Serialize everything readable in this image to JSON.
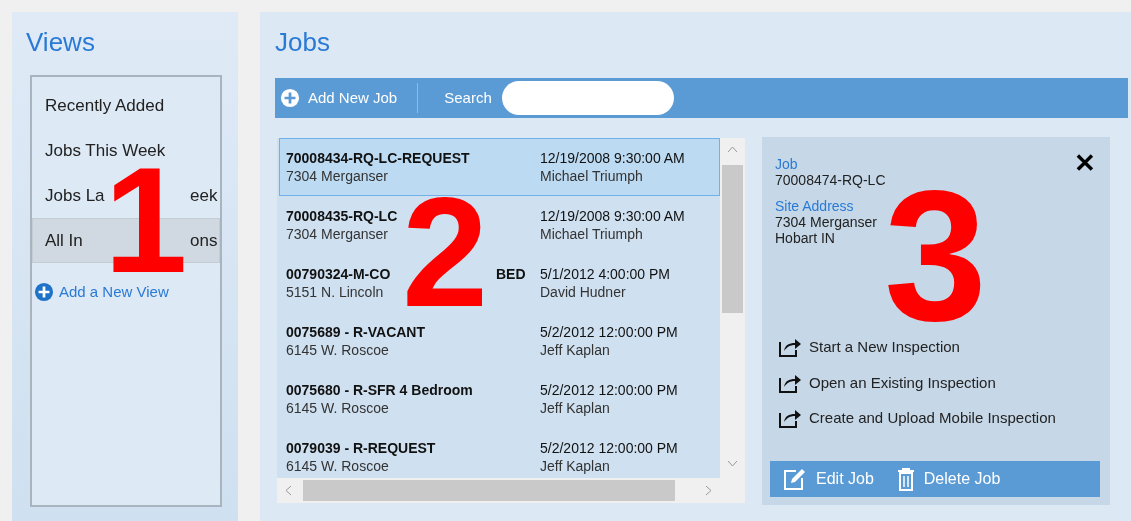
{
  "views": {
    "title": "Views",
    "items": [
      {
        "label": [
          "Recently Added"
        ],
        "selected": false
      },
      {
        "label": [
          "Jobs This Week"
        ],
        "selected": false
      },
      {
        "label": [
          "Jobs La",
          "eek"
        ],
        "selected": false
      },
      {
        "label": [
          "All In",
          "ons"
        ],
        "selected": true
      }
    ],
    "add_link": [
      "Add a New View"
    ]
  },
  "jobs": {
    "title": "Jobs",
    "toolbar": {
      "add_button": "Add New Job",
      "search_label": "Search"
    },
    "rows": [
      {
        "job": [
          "70008434-RQ-LC-REQUEST"
        ],
        "address": "7304 Merganser",
        "date": "12/19/2008 9:30:00 AM",
        "inspector": "Michael Triumph",
        "selected": true
      },
      {
        "job": [
          "70008435-RQ-LC"
        ],
        "address": "7304 Merganser",
        "date": "12/19/2008 9:30:00 AM",
        "inspector": "Michael Triumph",
        "selected": false
      },
      {
        "job": [
          "00790324-M-CO",
          "BED"
        ],
        "address": "5151 N. Lincoln",
        "date": "5/1/2012 4:00:00 PM",
        "inspector": "David Hudner",
        "selected": false
      },
      {
        "job": [
          "0075689 - R-VACANT"
        ],
        "address": "6145 W. Roscoe",
        "date": "5/2/2012 12:00:00 PM",
        "inspector": "Jeff Kaplan",
        "selected": false
      },
      {
        "job": [
          "0075680 - R-SFR 4 Bedroom"
        ],
        "address": "6145 W. Roscoe",
        "date": "5/2/2012 12:00:00 PM",
        "inspector": "Jeff Kaplan",
        "selected": false
      },
      {
        "job": [
          "0079039 - R-REQUEST"
        ],
        "address": "6145 W. Roscoe",
        "date": "5/2/2012 12:00:00 PM",
        "inspector": "Jeff Kaplan",
        "selected": false
      }
    ]
  },
  "detail": {
    "job_label": "Job",
    "job": "70008474-RQ-LC",
    "site_label": "Site Address",
    "address_lines": [
      "7304 Merganser",
      "Hobart IN"
    ],
    "close": "✕",
    "actions": [
      "Start a New Inspection",
      "Open an Existing Inspection",
      "Create and Upload Mobile Inspection"
    ],
    "edit_button": "Edit Job",
    "delete_button": "Delete Job"
  },
  "callouts": [
    "1",
    "2",
    "3"
  ]
}
